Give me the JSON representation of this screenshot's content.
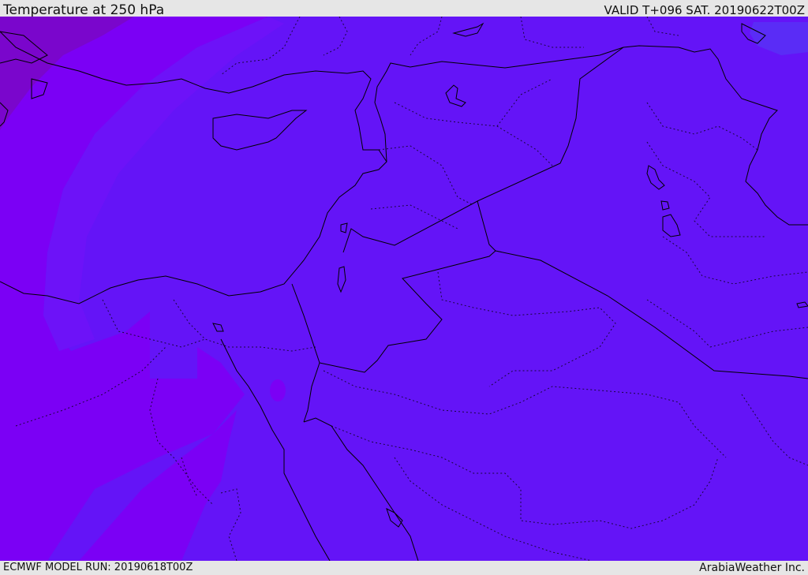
{
  "header": {
    "title": "Temperature at 250 hPa",
    "valid_time": "VALID T+096 SAT. 20190622T00Z"
  },
  "footer": {
    "model_run": "ECMWF MODEL RUN: 20190618T00Z",
    "credit": "ArabiaWeather Inc."
  },
  "map": {
    "colors": {
      "cold_band_dark": "#7a06cc",
      "cold_band": "#7b00f5",
      "mid_band": "#6a10f8",
      "base": "#6414f7",
      "warm_spot": "#5a2cf6",
      "boundary_line": "#000000"
    }
  }
}
